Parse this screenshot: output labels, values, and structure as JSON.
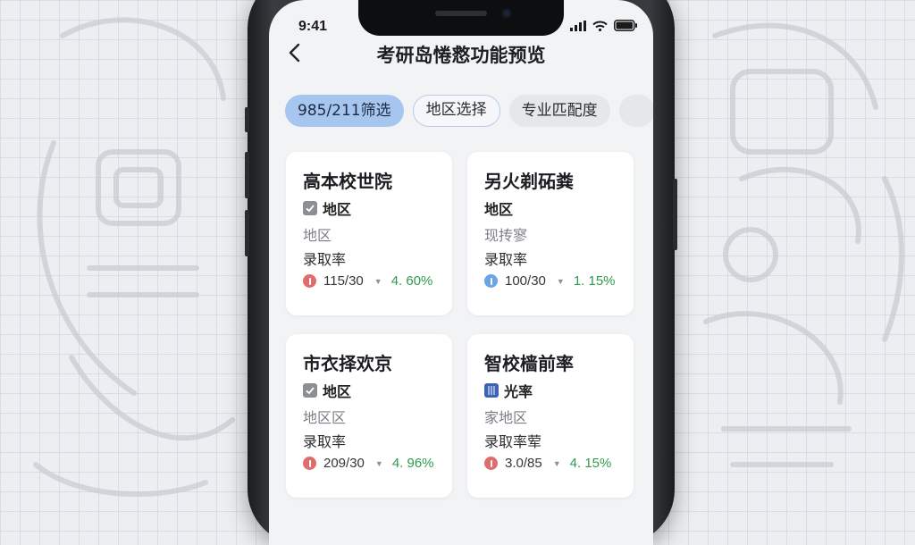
{
  "status_bar": {
    "time": "9:41"
  },
  "nav": {
    "title": "考研岛惓慦功能预览"
  },
  "chips": [
    {
      "label": "985/211筛选"
    },
    {
      "label": "地区选择"
    },
    {
      "label": "专业匹配度"
    }
  ],
  "cards": [
    {
      "title": "高本校世院",
      "tag": "地区",
      "tag_icon": "checkbox-icon",
      "subtitle": "地区",
      "label": "录取率",
      "ratio": "115/30",
      "percent": "4. 60%",
      "indicator_color": "#e06c6c"
    },
    {
      "title": "另火剃砳粪",
      "tag": "地区",
      "tag_icon": "",
      "subtitle": "现抟寥",
      "label": "录取率",
      "ratio": "100/30",
      "percent": "1. 15%",
      "indicator_color": "#6aa3e6"
    },
    {
      "title": "市衣择欢京",
      "tag": "地区",
      "tag_icon": "checkbox-icon",
      "subtitle": "地区区",
      "label": "录取率",
      "ratio": "209/30",
      "percent": "4. 96%",
      "indicator_color": "#e06c6c"
    },
    {
      "title": "智校樯前率",
      "tag": "光率",
      "tag_icon": "book-icon",
      "subtitle": "家地区",
      "label": "录取率荤",
      "ratio": "3.0/85",
      "percent": "4. 15%",
      "indicator_color": "#e06c6c"
    }
  ],
  "colors": {
    "accent_chip": "#a7c6ef",
    "percent_green": "#2e9a4e",
    "indicator_red": "#e06c6c",
    "indicator_blue": "#6aa3e6"
  }
}
